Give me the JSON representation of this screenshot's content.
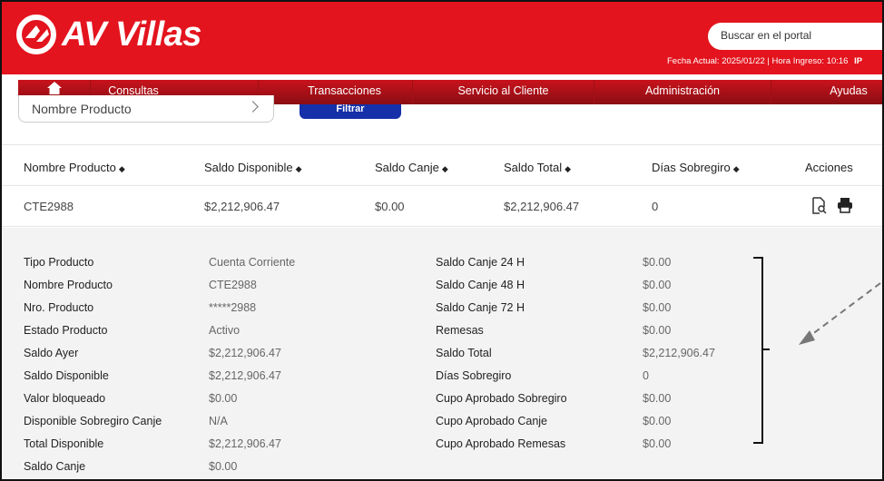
{
  "header": {
    "logo_text": "AV Villas",
    "search_placeholder": "Buscar en el portal",
    "fecha_info": "Fecha Actual: 2025/01/22 | Hora Ingreso: 10:16",
    "ip_label": "IP",
    "brand_color": "#e3141e"
  },
  "nav": {
    "home_icon": "home-icon",
    "items": [
      "Consultas",
      "Transacciones",
      "Servicio al Cliente",
      "Administración",
      "Ayudas"
    ]
  },
  "filter": {
    "product_select": "Nombre Producto",
    "button_label": "Filtrar"
  },
  "table": {
    "columns": [
      "Nombre Producto",
      "Saldo Disponible",
      "Saldo Canje",
      "Saldo Total",
      "Días Sobregiro",
      "Acciones"
    ],
    "rows": [
      [
        "CTE2988",
        "$2,212,906.47",
        "$0.00",
        "$2,212,906.47",
        "0"
      ]
    ]
  },
  "detail": {
    "left": [
      {
        "label": "Tipo Producto",
        "value": "Cuenta Corriente"
      },
      {
        "label": "Nombre Producto",
        "value": "CTE2988"
      },
      {
        "label": "Nro. Producto",
        "value": "*****2988"
      },
      {
        "label": "Estado Producto",
        "value": "Activo"
      },
      {
        "label": "Saldo Ayer",
        "value": "$2,212,906.47"
      },
      {
        "label": "Saldo Disponible",
        "value": "$2,212,906.47"
      },
      {
        "label": "Valor bloqueado",
        "value": "$0.00"
      },
      {
        "label": "Disponible Sobregiro Canje",
        "value": "N/A"
      },
      {
        "label": "Total Disponible",
        "value": "$2,212,906.47"
      },
      {
        "label": "Saldo Canje",
        "value": "$0.00"
      }
    ],
    "right": [
      {
        "label": "Saldo Canje 24 H",
        "value": "$0.00"
      },
      {
        "label": "Saldo Canje 48 H",
        "value": "$0.00"
      },
      {
        "label": "Saldo Canje 72 H",
        "value": "$0.00"
      },
      {
        "label": "Remesas",
        "value": "$0.00"
      },
      {
        "label": "Saldo Total",
        "value": "$2,212,906.47"
      },
      {
        "label": "Días Sobregiro",
        "value": "0"
      },
      {
        "label": "Cupo Aprobado Sobregiro",
        "value": "$0.00"
      },
      {
        "label": "Cupo Aprobado Canje",
        "value": "$0.00"
      },
      {
        "label": "Cupo Aprobado Remesas",
        "value": "$0.00"
      }
    ]
  }
}
